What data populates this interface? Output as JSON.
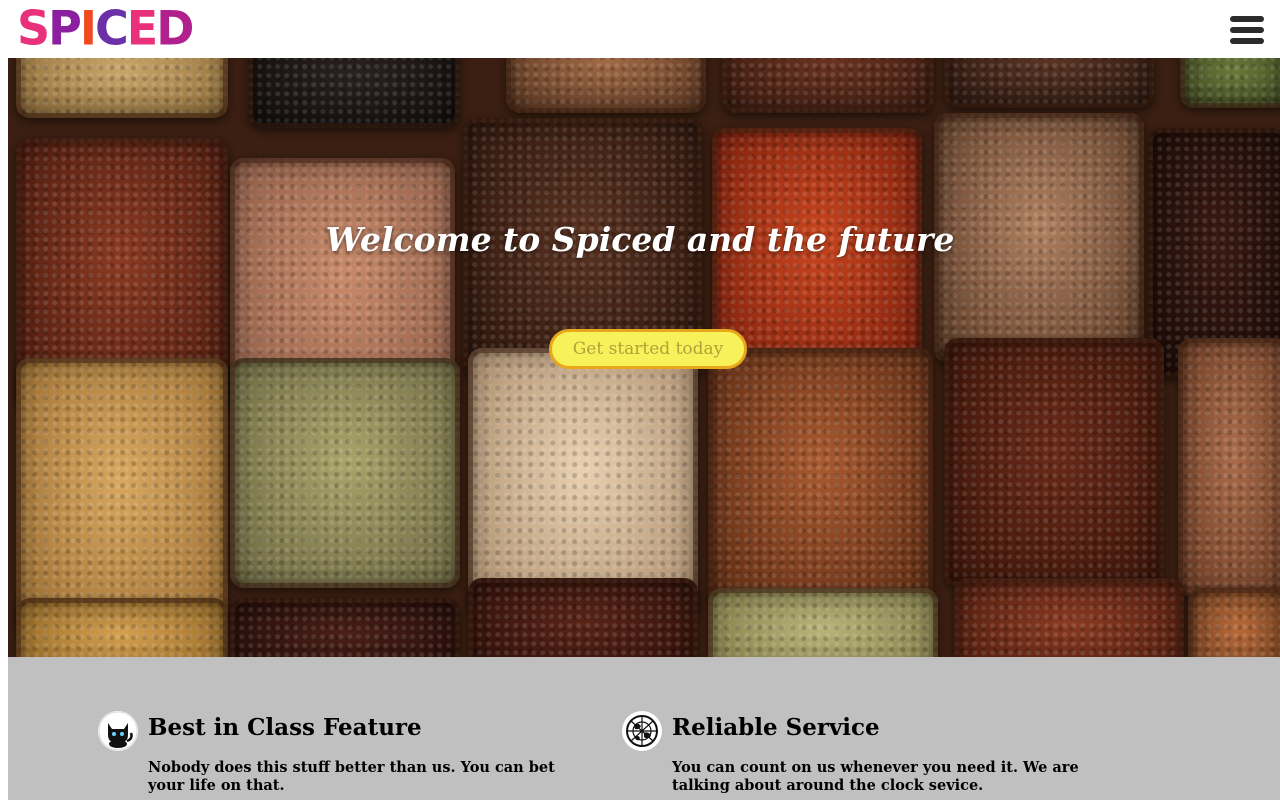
{
  "header": {
    "logo_letters": [
      "S",
      "P",
      "I",
      "C",
      "E",
      "D"
    ],
    "logo_colors": [
      "#e8317a",
      "#8a1fa0",
      "#f04a1e",
      "#6b2fa8",
      "#e8317a",
      "#b0218e"
    ],
    "menu_icon": "hamburger-menu-icon"
  },
  "hero": {
    "title": "Welcome to Spiced and the future",
    "cta_label": "Get started today",
    "image": "spice-market-sacks"
  },
  "features": [
    {
      "icon": "black-cat-icon",
      "title": "Best in Class Feature",
      "text": "Nobody does this stuff better than us. You can bet your life on that."
    },
    {
      "icon": "globe-icon",
      "title": "Reliable Service",
      "text": "You can count on us whenever you need it. We are talking about around the clock sevice."
    }
  ],
  "colors": {
    "cta_background": "#f7f25a",
    "cta_border": "#e9a71c",
    "features_background": "#c0c0c0"
  }
}
